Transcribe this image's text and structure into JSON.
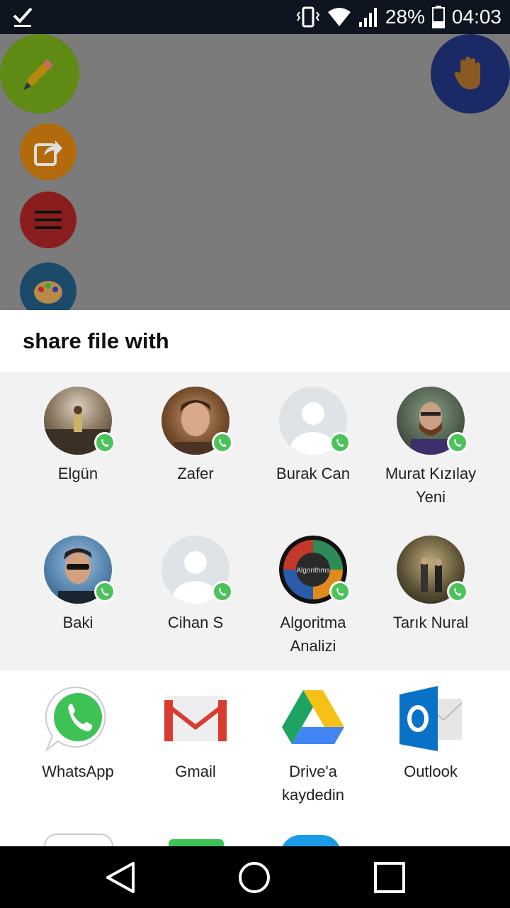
{
  "status_bar": {
    "left_icon": "checkmark-download-icon",
    "battery_percent": "28%",
    "time": "04:03",
    "icons": [
      "vibrate-icon",
      "wifi-icon",
      "signal-icon",
      "battery-icon"
    ]
  },
  "background_app": {
    "fabs": [
      "pencil-icon",
      "share-icon",
      "menu-icon",
      "palette-icon",
      "hand-icon"
    ],
    "colors": {
      "green": "#5f8a14",
      "orange": "#b36a0c",
      "red": "#8a1e1e",
      "blue": "#1b4a6b",
      "navy": "#1b2a66"
    }
  },
  "sheet": {
    "title": "share file with",
    "direct_share": [
      {
        "name_line1": "Elgün",
        "name_line2": ""
      },
      {
        "name_line1": "Zafer",
        "name_line2": ""
      },
      {
        "name_line1": "Burak Can",
        "name_line2": ""
      },
      {
        "name_line1": "Murat Kızılay",
        "name_line2": "Yeni"
      },
      {
        "name_line1": "Baki",
        "name_line2": ""
      },
      {
        "name_line1": "Cihan S",
        "name_line2": ""
      },
      {
        "name_line1": "Algoritma",
        "name_line2": "Analizi"
      },
      {
        "name_line1": "Tarık Nural",
        "name_line2": ""
      }
    ],
    "apps": [
      {
        "label_line1": "WhatsApp",
        "label_line2": ""
      },
      {
        "label_line1": "Gmail",
        "label_line2": ""
      },
      {
        "label_line1": "Drive'a",
        "label_line2": "kaydedin"
      },
      {
        "label_line1": "Outlook",
        "label_line2": ""
      }
    ],
    "algorithm_avatar_text": "Algorithms"
  },
  "nav_bar": {
    "buttons": [
      "back-icon",
      "home-icon",
      "recents-icon"
    ]
  }
}
